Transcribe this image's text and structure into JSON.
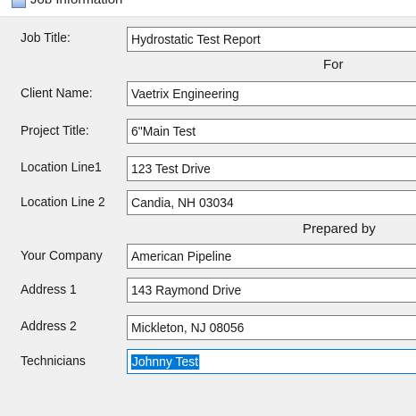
{
  "window": {
    "title": "Job Information"
  },
  "sections": {
    "for": "For",
    "prepared_by": "Prepared by"
  },
  "fields": {
    "job_title": {
      "label": "Job Title:",
      "value": "Hydrostatic Test Report"
    },
    "client_name": {
      "label": "Client Name:",
      "value": "Vaetrix Engineering"
    },
    "project_title": {
      "label": "Project Title:",
      "value": "6\"Main Test"
    },
    "location_line_1": {
      "label": "Location Line1",
      "value": "123 Test Drive"
    },
    "location_line_2": {
      "label": "Location Line 2",
      "value": "Candia, NH 03034"
    },
    "your_company": {
      "label": "Your Company",
      "value": "American Pipeline"
    },
    "address_1": {
      "label": "Address 1",
      "value": "143 Raymond Drive"
    },
    "address_2": {
      "label": "Address 2",
      "value": "Mickleton, NJ 08056"
    },
    "technicians": {
      "label": "Technicians",
      "value": "Johnny Test"
    }
  },
  "colors": {
    "background": "#f0f0f0",
    "field_border": "#7a7a7a",
    "focus_border": "#0078d7",
    "selection": "#0078d7"
  }
}
